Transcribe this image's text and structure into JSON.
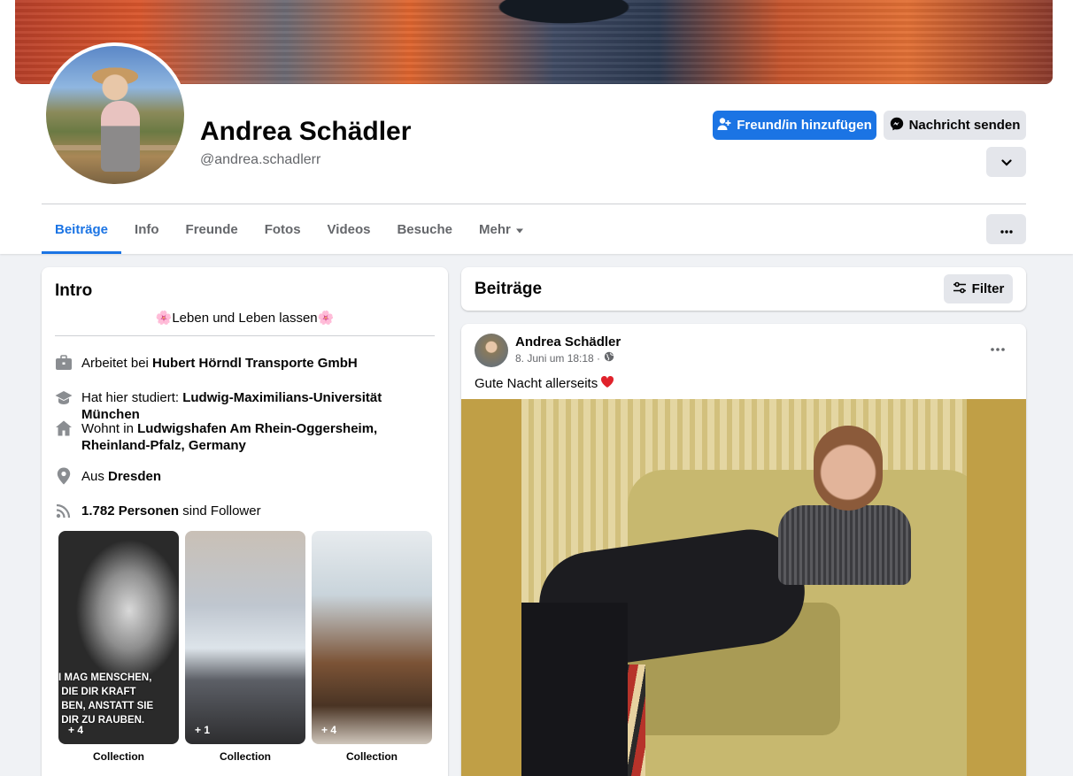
{
  "profile": {
    "name": "Andrea Schädler",
    "handle": "@andrea.schadlerr",
    "add_friend_label": "Freund/in hinzufügen",
    "message_label": "Nachricht senden"
  },
  "tabs": [
    {
      "label": "Beiträge",
      "active": true
    },
    {
      "label": "Info"
    },
    {
      "label": "Freunde"
    },
    {
      "label": "Fotos"
    },
    {
      "label": "Videos"
    },
    {
      "label": "Besuche"
    },
    {
      "label": "Mehr"
    }
  ],
  "intro": {
    "title": "Intro",
    "bio": "🌸Leben und Leben lassen🌸",
    "work": {
      "prefix": "Arbeitet bei ",
      "value": "Hubert Hörndl Transporte GmbH"
    },
    "study": {
      "prefix": "Hat hier studiert: ",
      "value": "Ludwig-Maximilians-Universität München"
    },
    "lives": {
      "prefix": "Wohnt in ",
      "value": "Ludwigshafen Am Rhein-Oggersheim, Rheinland-Pfalz, Germany"
    },
    "from": {
      "prefix": "Aus ",
      "value": "Dresden"
    },
    "followers": {
      "value": "1.782 Personen",
      "suffix": " sind Follower"
    },
    "collections": [
      {
        "count": "+ 4",
        "caption": "Collection",
        "quote": "I MAG MENSCHEN,\n DIE DIR KRAFT\n BEN, ANSTATT SIE\n DIR ZU RAUBEN."
      },
      {
        "count": "+ 1",
        "caption": "Collection"
      },
      {
        "count": "+ 4",
        "caption": "Collection"
      }
    ]
  },
  "posts": {
    "title": "Beiträge",
    "filter_label": "Filter"
  },
  "post": {
    "author": "Andrea Schädler",
    "date": "8. Juni um 18:18 ·",
    "text": "Gute Nacht allerseits"
  },
  "colors": {
    "accent": "#1b74e4",
    "background": "#f0f2f5",
    "secondary_button": "#e4e6eb",
    "muted_text": "#65676b"
  }
}
